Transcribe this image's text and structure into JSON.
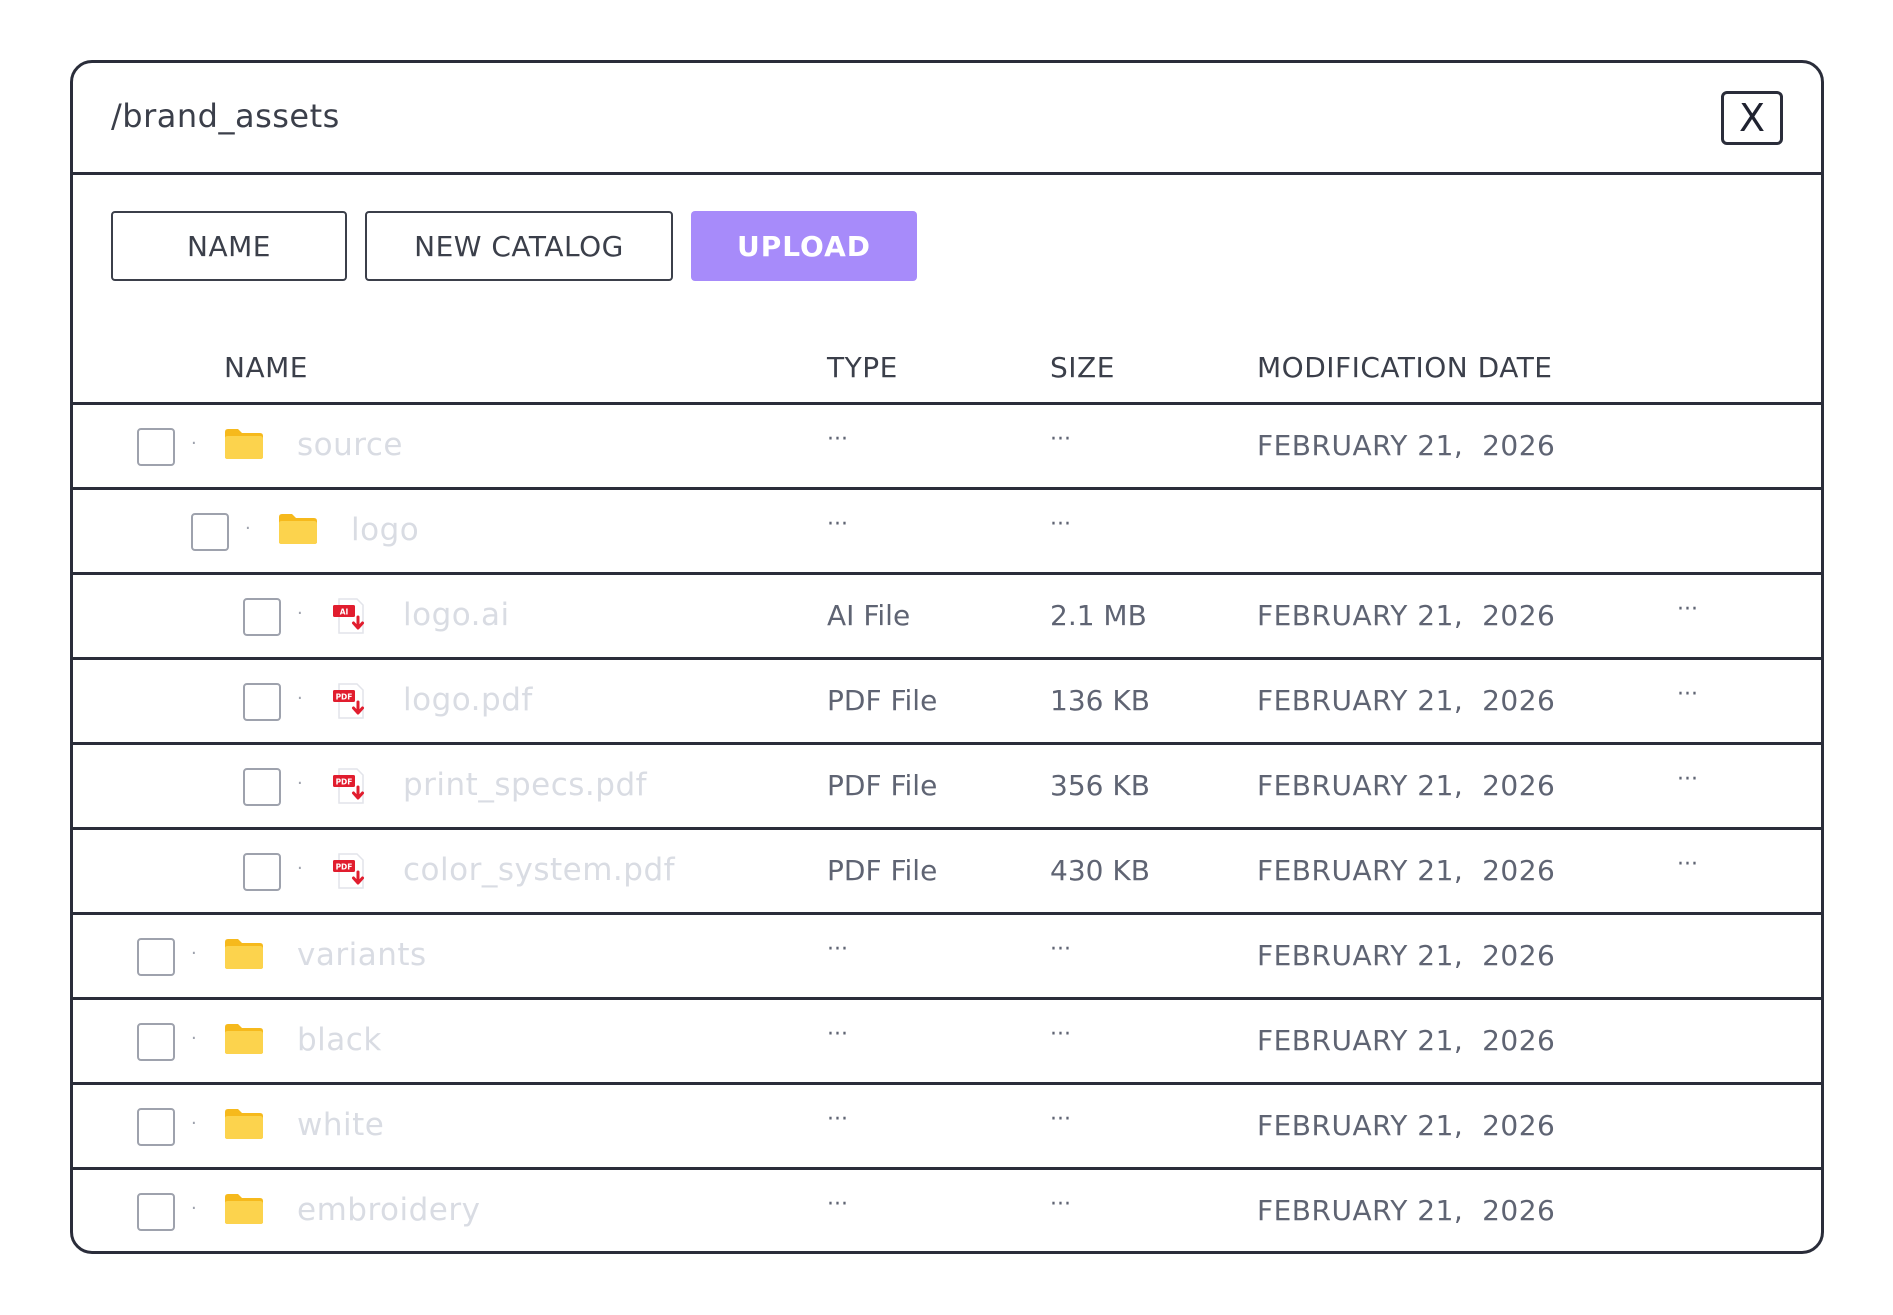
{
  "title": "/brand_assets",
  "close_label": "X",
  "toolbar": {
    "name_label": "NAME",
    "new_catalog_label": "NEW CATALOG",
    "upload_label": "UPLOAD"
  },
  "colors": {
    "accent": "#a78bfa",
    "folder": "#fcd34d",
    "file_icon_red": "#e11d2e"
  },
  "columns": {
    "name": "NAME",
    "type": "TYPE",
    "size": "SIZE",
    "date": "MODIFICATION DATE"
  },
  "rows": [
    {
      "name": "source",
      "kind": "folder",
      "level": 0,
      "type": "···",
      "size": "···",
      "date": "FEBRUARY 21,  2026",
      "more": ""
    },
    {
      "name": "logo",
      "kind": "folder",
      "level": 1,
      "type": "···",
      "size": "···",
      "date": "",
      "more": ""
    },
    {
      "name": "logo.ai",
      "kind": "file",
      "badge": "AI",
      "level": 2,
      "type": "AI File",
      "size": "2.1 MB",
      "date": "FEBRUARY 21,  2026",
      "more": "···"
    },
    {
      "name": "logo.pdf",
      "kind": "file",
      "badge": "PDF",
      "level": 2,
      "type": "PDF File",
      "size": "136 KB",
      "date": "FEBRUARY 21,  2026",
      "more": "···"
    },
    {
      "name": "print_specs.pdf",
      "kind": "file",
      "badge": "PDF",
      "level": 2,
      "type": "PDF File",
      "size": "356 KB",
      "date": "FEBRUARY 21,  2026",
      "more": "···"
    },
    {
      "name": "color_system.pdf",
      "kind": "file",
      "badge": "PDF",
      "level": 2,
      "type": "PDF File",
      "size": "430 KB",
      "date": "FEBRUARY 21,  2026",
      "more": "···"
    },
    {
      "name": "variants",
      "kind": "folder",
      "level": 0,
      "type": "···",
      "size": "···",
      "date": "FEBRUARY 21,  2026",
      "more": ""
    },
    {
      "name": "black",
      "kind": "folder",
      "level": 0,
      "type": "···",
      "size": "···",
      "date": "FEBRUARY 21,  2026",
      "more": ""
    },
    {
      "name": "white",
      "kind": "folder",
      "level": 0,
      "type": "···",
      "size": "···",
      "date": "FEBRUARY 21,  2026",
      "more": ""
    },
    {
      "name": "embroidery",
      "kind": "folder",
      "level": 0,
      "type": "···",
      "size": "···",
      "date": "FEBRUARY 21,  2026",
      "more": ""
    }
  ]
}
